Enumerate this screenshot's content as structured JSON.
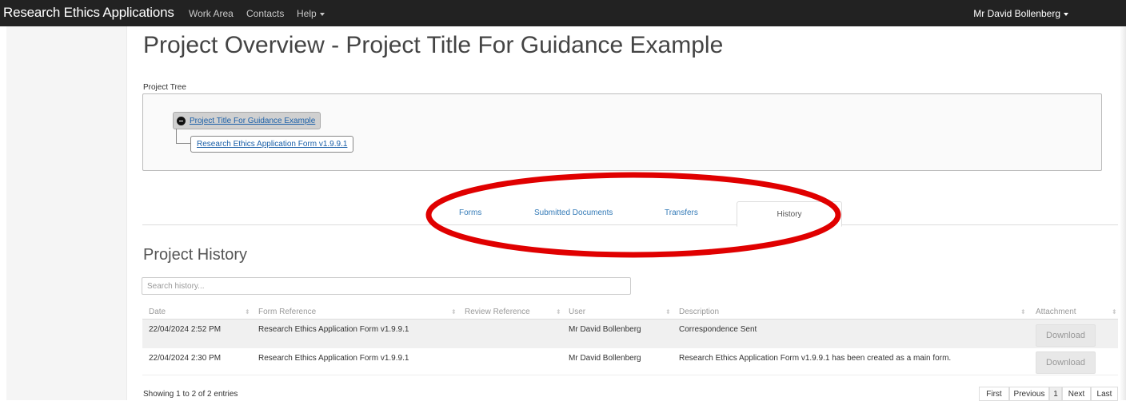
{
  "navbar": {
    "brand": "Research Ethics Applications",
    "links": [
      "Work Area",
      "Contacts",
      "Help"
    ],
    "user": "Mr David Bollenberg"
  },
  "page_title": "Project Overview - Project Title For Guidance Example",
  "project_tree": {
    "label": "Project Tree",
    "root": "Project Title For Guidance Example",
    "child": "Research Ethics Application Form v1.9.9.1"
  },
  "tabs": [
    "Forms",
    "Submitted Documents",
    "Transfers",
    "History"
  ],
  "active_tab": "History",
  "history": {
    "title": "Project History",
    "search_placeholder": "Search history...",
    "columns": [
      "Date",
      "Form Reference",
      "Review Reference",
      "User",
      "Description",
      "Attachment"
    ],
    "rows": [
      {
        "date": "22/04/2024 2:52 PM",
        "form_reference": "Research Ethics Application Form v1.9.9.1",
        "review_reference": "",
        "user": "Mr David Bollenberg",
        "description": "Correspondence Sent",
        "attachment": "Download"
      },
      {
        "date": "22/04/2024 2:30 PM",
        "form_reference": "Research Ethics Application Form v1.9.9.1",
        "review_reference": "",
        "user": "Mr David Bollenberg",
        "description": "Research Ethics Application Form v1.9.9.1 has been created as a main form.",
        "attachment": "Download"
      }
    ],
    "info": "Showing 1 to 2 of 2 entries",
    "pagination": [
      "First",
      "Previous",
      "1",
      "Next",
      "Last"
    ]
  },
  "colors": {
    "navbar": "#222222",
    "link": "#337ab7",
    "highlight_ellipse": "#e00000"
  }
}
